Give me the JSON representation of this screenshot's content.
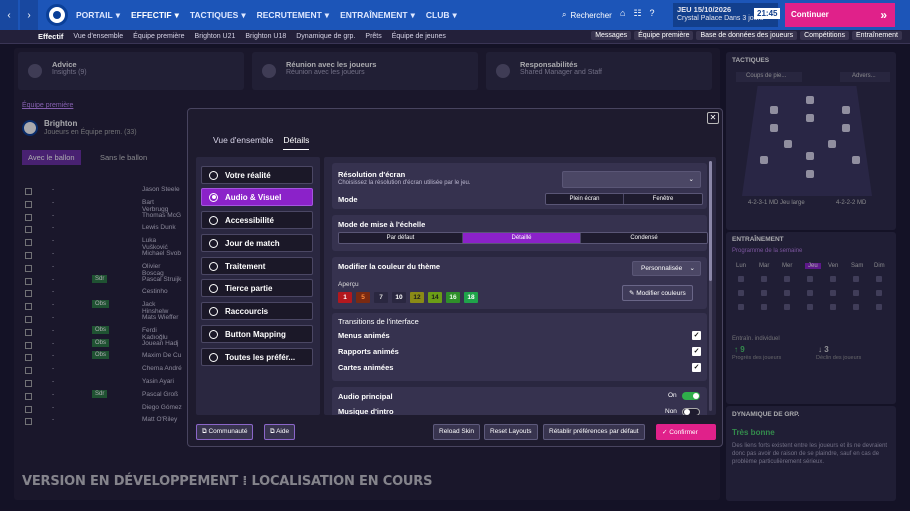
{
  "topbar": {
    "nav": [
      {
        "label": "PORTAIL",
        "active": false
      },
      {
        "label": "EFFECTIF",
        "active": true
      },
      {
        "label": "TACTIQUES",
        "active": false
      },
      {
        "label": "RECRUTEMENT",
        "active": false
      },
      {
        "label": "ENTRAÎNEMENT",
        "active": false
      },
      {
        "label": "CLUB",
        "active": false
      }
    ],
    "search": "Rechercher",
    "date": "JEU 15/10/2026",
    "next_match": "Crystal Palace  Dans 3 jours",
    "time": "21:45",
    "continue": "Continuer"
  },
  "subnav": {
    "items": [
      "Effectif",
      "Vue d'ensemble",
      "Équipe première",
      "Brighton U21",
      "Brighton U18",
      "Dynamique de grp.",
      "Prêts",
      "Équipe de jeunes"
    ],
    "right": [
      "Messages",
      "Équipe première",
      "Base de données des joueurs",
      "Compétitions",
      "Entraînement"
    ]
  },
  "background": {
    "cards": [
      {
        "title": "Advice",
        "sub": "Insights (9)"
      },
      {
        "title": "Réunion avec les joueurs",
        "sub": "Réunion avec les joueurs"
      },
      {
        "title": "Responsabilités",
        "sub": "Shared  Manager and Staff"
      }
    ],
    "team_label": "Équipe première",
    "team_name": "Brighton",
    "team_sub": "Joueurs en Équipe prem. (33)",
    "with_ball": "Avec le ballon",
    "no_ball": "Sans le ballon",
    "players": [
      {
        "name": "Jason Steele",
        "pos": ""
      },
      {
        "name": "Bart Verbrugg",
        "pos": ""
      },
      {
        "name": "Thomas McG",
        "pos": ""
      },
      {
        "name": "Lewis Dunk",
        "pos": ""
      },
      {
        "name": "Luka Vušković",
        "pos": ""
      },
      {
        "name": "Michael Svob",
        "pos": ""
      },
      {
        "name": "Olivier Boscag",
        "pos": ""
      },
      {
        "name": "Pascal Struijk",
        "pos": "Sdr"
      },
      {
        "name": "Cestinho",
        "pos": ""
      },
      {
        "name": "Jack Hinshelw",
        "pos": "Obs"
      },
      {
        "name": "Mats Wieffer",
        "pos": ""
      },
      {
        "name": "Ferdi Kadıoğlu",
        "pos": "Obs"
      },
      {
        "name": "Jouean Hadj",
        "pos": "Obs"
      },
      {
        "name": "Maxim De Cu",
        "pos": "Obs"
      },
      {
        "name": "Chema André",
        "pos": ""
      },
      {
        "name": "Yasin Ayari",
        "pos": ""
      },
      {
        "name": "Pascal Groß",
        "pos": "Sdr"
      },
      {
        "name": "Diego Gómez",
        "pos": ""
      },
      {
        "name": "Matt O'Riley",
        "pos": ""
      }
    ],
    "tactics_title": "TACTIQUES",
    "tactics_btn": "Coups de pie...",
    "tactics_adv": "Advers...",
    "formation_a": "4-2-3-1 MD Jeu large",
    "formation_b": "4-2-2-2 MD",
    "training_title": "ENTRAÎNEMENT",
    "training_sub": "Programme de la semaine",
    "days": [
      "Lun",
      "Mar",
      "Mer",
      "Jeu",
      "Ven",
      "Sam",
      "Dim"
    ],
    "training_individual": "Entraîn. individuel",
    "improve_count": "9",
    "decline_count": "3",
    "improve_label": "Progrès des joueurs",
    "decline_label": "Déclin des joueurs",
    "dynamics_title": "DYNAMIQUE DE GRP.",
    "dynamics_status": "Très bonne",
    "dynamics_text": "Des liens forts existent entre les joueurs et ils ne devraient donc pas avoir de raison de se plaindre, sauf en cas de problème particulièrement sérieux.",
    "watermark": "VERSION EN DÉVELOPPEMENT ⁞ LOCALISATION EN COURS"
  },
  "modal": {
    "tabs": [
      {
        "label": "Vue d'ensemble",
        "active": false
      },
      {
        "label": "Détails",
        "active": true
      }
    ],
    "nav": [
      {
        "label": "Votre réalité",
        "active": false
      },
      {
        "label": "Audio & Visuel",
        "active": true
      },
      {
        "label": "Accessibilité",
        "active": false
      },
      {
        "label": "Jour de match",
        "active": false
      },
      {
        "label": "Traitement",
        "active": false
      },
      {
        "label": "Tierce partie",
        "active": false
      },
      {
        "label": "Raccourcis",
        "active": false
      },
      {
        "label": "Button Mapping",
        "active": false
      },
      {
        "label": "Toutes les préfér...",
        "active": false
      }
    ],
    "resolution": {
      "title": "Résolution d'écran",
      "desc": "Choisissez la résolution d'écran utilisée par le jeu.",
      "value": "",
      "mode_label": "Mode",
      "modes": [
        {
          "label": "Plein écran",
          "on": false
        },
        {
          "label": "Fenêtre",
          "on": false
        }
      ]
    },
    "scaling": {
      "title": "Mode de mise à l'échelle",
      "options": [
        {
          "label": "Par défaut",
          "on": false
        },
        {
          "label": "Détaillé",
          "on": true
        },
        {
          "label": "Condensé",
          "on": false
        }
      ]
    },
    "theme": {
      "title": "Modifier la couleur du thème",
      "preset": "Personnalisée",
      "preview_label": "Aperçu",
      "chips": [
        {
          "v": "1",
          "bg": "#b3181e",
          "fg": "#fff"
        },
        {
          "v": "5",
          "bg": "#7a2a12",
          "fg": "#ff8a3a"
        },
        {
          "v": "7",
          "bg": "#2a2740",
          "fg": "#ddd"
        },
        {
          "v": "10",
          "bg": "#2a2740",
          "fg": "#fff"
        },
        {
          "v": "12",
          "bg": "#8a8a16",
          "fg": "#1b1b1b"
        },
        {
          "v": "14",
          "bg": "#6b9d16",
          "fg": "#1b1b1b"
        },
        {
          "v": "16",
          "bg": "#2f8f2a",
          "fg": "#e9ffe9"
        },
        {
          "v": "18",
          "bg": "#1fa34a",
          "fg": "#fff"
        }
      ],
      "modify_button": "Modifier couleurs"
    },
    "transitions": {
      "title": "Transitions de l'interface",
      "items": [
        {
          "label": "Menus animés",
          "checked": true
        },
        {
          "label": "Rapports animés",
          "checked": true
        },
        {
          "label": "Cartes animées",
          "checked": true
        }
      ]
    },
    "audio": {
      "main_label": "Audio principal",
      "main_state": "On",
      "intro_label": "Musique d'intro",
      "intro_state": "Non"
    },
    "footer": {
      "community": "Communauté",
      "help": "Aide",
      "reload": "Reload Skin",
      "reset": "Reset Layouts",
      "restore": "Rétablir préférences par défaut",
      "confirm": "Confirmer"
    },
    "colors": {
      "accent": "#8b22c9",
      "confirm": "#e0218a",
      "toggle_on": "#2fae4a"
    }
  }
}
